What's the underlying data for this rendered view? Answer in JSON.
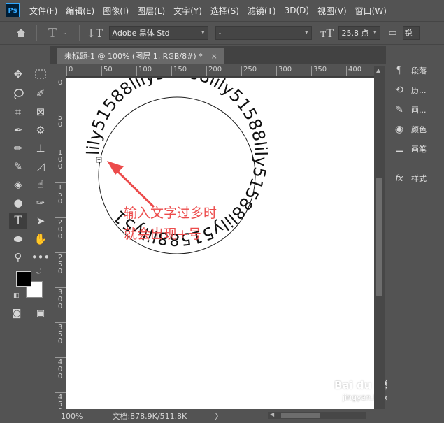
{
  "menu": {
    "logo": "Ps",
    "items": [
      "文件(F)",
      "编辑(E)",
      "图像(I)",
      "图层(L)",
      "文字(Y)",
      "选择(S)",
      "滤镜(T)",
      "3D(D)",
      "视图(V)",
      "窗口(W)"
    ]
  },
  "options": {
    "font_family": "Adobe 黑体 Std",
    "font_style": "-",
    "font_size": "25.8 点",
    "antialias": "锐"
  },
  "document": {
    "tab_title": "未标题-1 @ 100% (图层 1, RGB/8#) *",
    "close": "×"
  },
  "rulers": {
    "horizontal": [
      "0",
      "50",
      "100",
      "150",
      "200",
      "250",
      "300",
      "350",
      "400"
    ],
    "vertical": [
      "0",
      "5\n0",
      "1\n0\n0",
      "1\n5\n0",
      "2\n0\n0",
      "2\n5\n0",
      "3\n0\n0",
      "3\n5\n0",
      "4\n0\n0",
      "4\n5\n0"
    ]
  },
  "canvas": {
    "path_text": "lily51588lily51588lily51588lily51588lily51588lily51",
    "annotation_line1": "输入文字过多时",
    "annotation_line2": "就会出现+号",
    "annotation_color": "#ec4b4b"
  },
  "status": {
    "zoom": "100%",
    "doc_size": "文档:878.9K/511.8K",
    "arrow": "〉"
  },
  "panels": [
    {
      "icon": "paragraph-icon",
      "glyph": "¶",
      "label": "段落"
    },
    {
      "icon": "history-icon",
      "glyph": "⟲",
      "label": "历..."
    },
    {
      "icon": "brush-settings-icon",
      "glyph": "✎",
      "label": "画..."
    },
    {
      "icon": "color-icon",
      "glyph": "◉",
      "label": "颜色"
    },
    {
      "icon": "brush-icon",
      "glyph": "⚊",
      "label": "画笔"
    },
    {
      "icon": "styles-icon",
      "glyph": "fx",
      "label": "样式"
    }
  ],
  "watermark": {
    "brand": "Bai du 经验",
    "url": "jingyan.baidu.com"
  },
  "tools": [
    "move-icon",
    "marquee-icon",
    "lasso-icon",
    "quick-select-icon",
    "crop-icon",
    "frame-icon",
    "eyedropper-icon",
    "spot-heal-icon",
    "brush-icon",
    "stamp-icon",
    "history-brush-icon",
    "eraser-icon",
    "fill-icon",
    "blur-icon",
    "dodge-icon",
    "pen-icon",
    "type-icon",
    "path-select-icon",
    "ellipse-icon",
    "hand-icon",
    "zoom-icon",
    "more-icon"
  ]
}
